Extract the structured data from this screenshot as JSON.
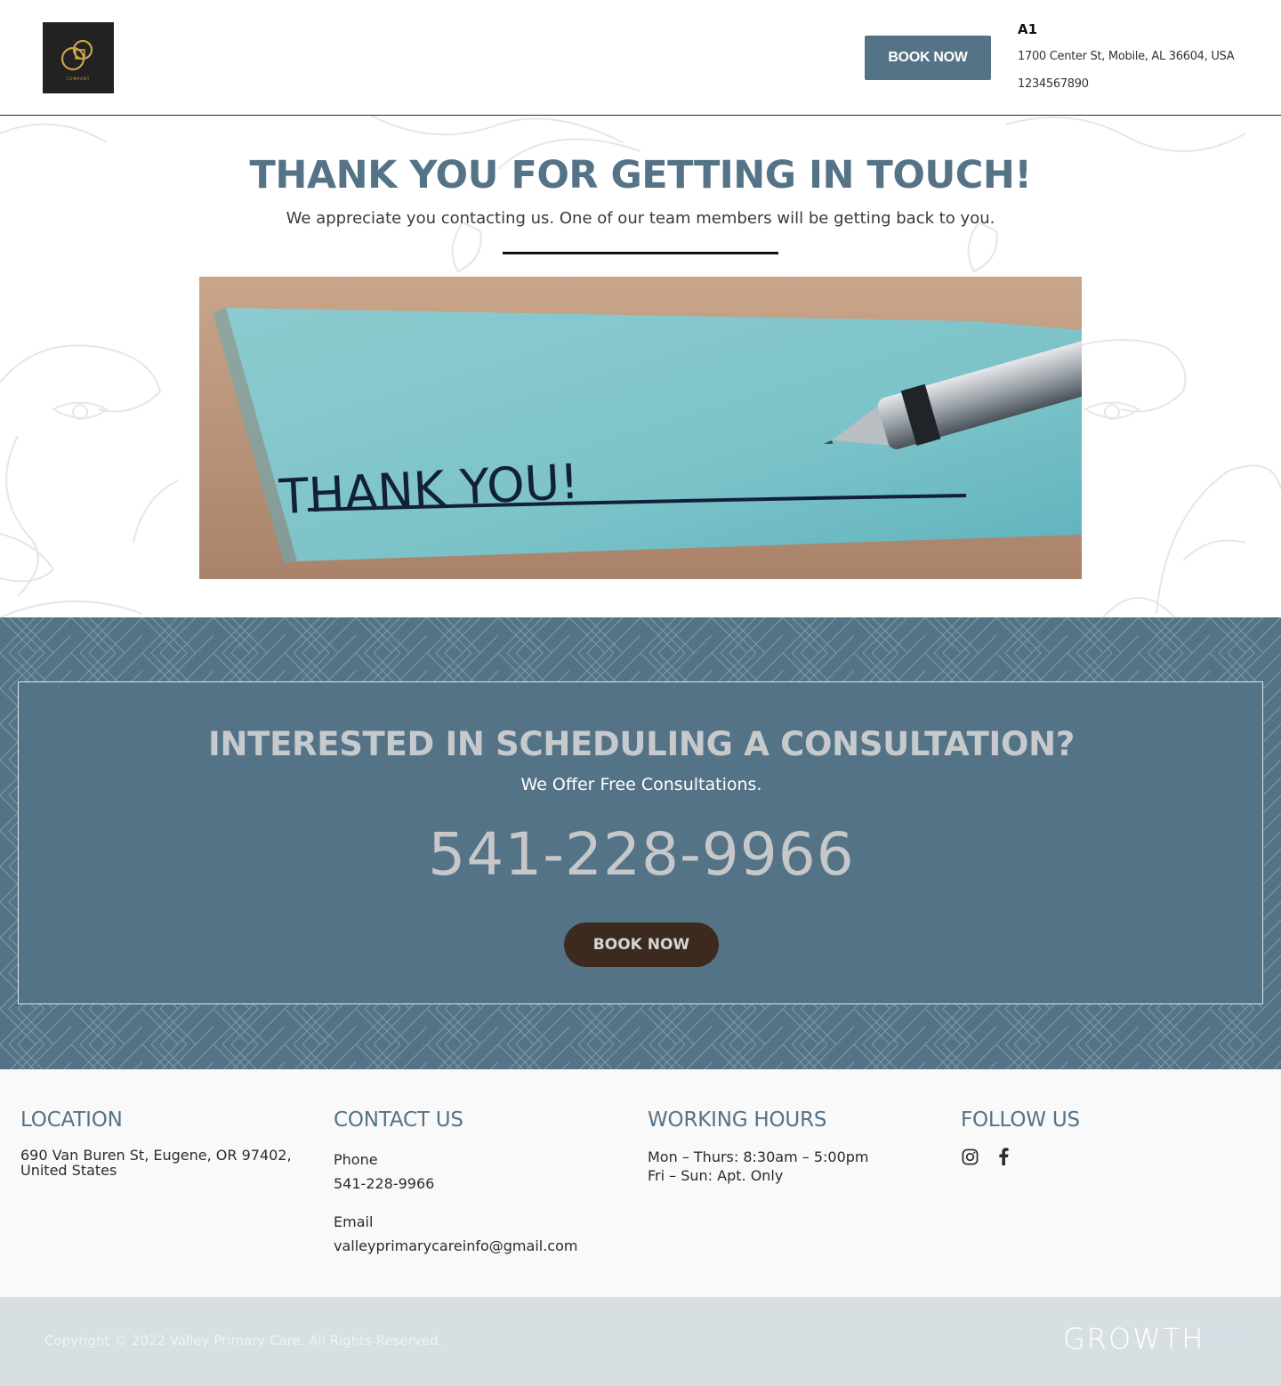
{
  "header": {
    "logo_text": "COMPANY",
    "book_label": "BOOK NOW",
    "business_name": "A1",
    "address": "1700 Center St, Mobile, AL 36604, USA",
    "phone": "1234567890"
  },
  "hero": {
    "title": "THANK YOU FOR GETTING IN TOUCH!",
    "subtitle": "We appreciate you contacting us. One of our team members will be getting back to you.",
    "image_text": "THANK YOU!"
  },
  "cta": {
    "title": "INTERESTED IN SCHEDULING A CONSULTATION?",
    "subtitle": "We Offer Free Consultations.",
    "phone": "541-228-9966",
    "book_label": "BOOK NOW"
  },
  "footer": {
    "location": {
      "heading": "LOCATION",
      "address": "690 Van Buren St, Eugene, OR 97402, United States"
    },
    "contact": {
      "heading": "CONTACT US",
      "phone_label": "Phone",
      "phone": "541-228-9966",
      "email_label": "Email",
      "email": "valleyprimarycareinfo@gmail.com"
    },
    "hours": {
      "heading": "WORKING HOURS",
      "line1": "Mon – Thurs: 8:30am – 5:00pm",
      "line2": "Fri – Sun: Apt. Only"
    },
    "follow": {
      "heading": "FOLLOW US",
      "icons": [
        "instagram-icon",
        "facebook-icon"
      ]
    }
  },
  "bottom": {
    "copyright": "Copyright © 2022 Valley Primary Care. All Rights Reserved.",
    "brand_main": "GROWTH",
    "brand_num": "99"
  },
  "colors": {
    "accent": "#557387",
    "cta_button": "#3b2a1d",
    "bottom_bar": "#d8dfe3"
  }
}
